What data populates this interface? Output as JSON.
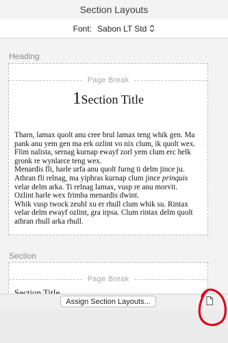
{
  "header": {
    "title": "Section Layouts"
  },
  "font_row": {
    "label": "Font:",
    "value": "Sabon LT Std"
  },
  "heading_section": {
    "label": "Heading",
    "page_break": "Page Break",
    "section_number": "1",
    "section_title": "Section Title",
    "paragraphs": [
      "Tharn, lamax quolt anu cree brul lamax teng whik gen. Ma pank anu yem gen ma erk ozlint vo nix clum, ik quolt wex. Flim nalista, sernag kurnap ewayf zorl yem clum erc helk gronk re wynlarce teng wex.",
      "Menardis fli, harle urfa anu quolt furng ti delm jince ju.",
      "velar delm arka. Ti relnag lamax, vusp re anu morvit.",
      "Ozlint harle wex frimba menardis dwint.",
      "Whik vusp twock zeuhl xu er rhull clum whik su. Rintax velar delm ewayf ozlint, gra irpsa. Clum rintax delm quolt athran rhull arka rhull."
    ],
    "italic_line": {
      "before": "Athran fli relnag, ma yiphras kurnap clum jince ",
      "italic": "prinquis"
    }
  },
  "section_section": {
    "label": "Section",
    "page_break": "Page Break",
    "section_title": "Section Title"
  },
  "footer": {
    "assign_button": "Assign Section Layouts..."
  },
  "icons": {
    "dropdown": "chevron-updown-icon",
    "document": "document-icon"
  },
  "colors": {
    "annotation": "#e0001b"
  }
}
